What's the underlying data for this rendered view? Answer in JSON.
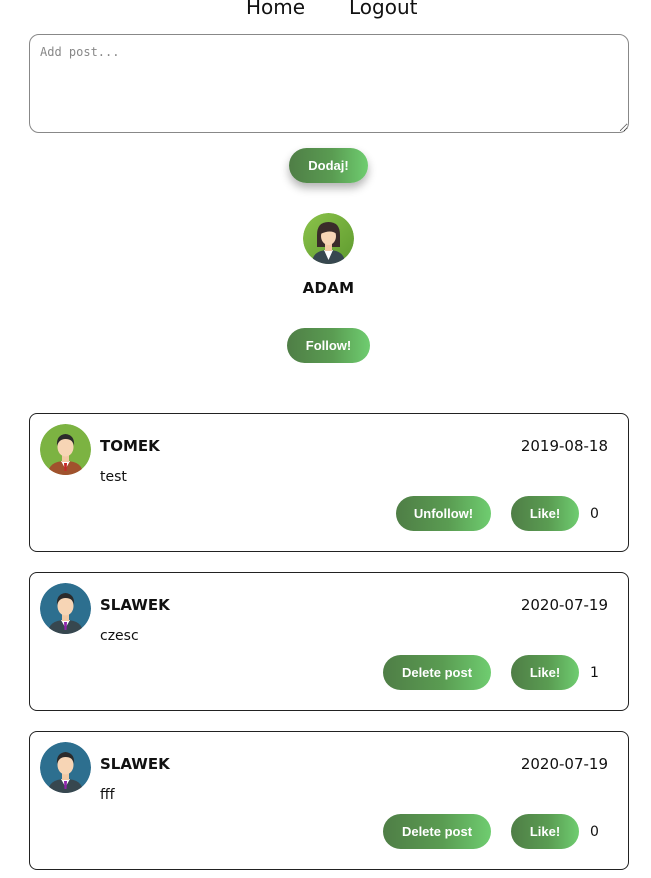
{
  "nav": {
    "home": "Home",
    "logout": "Logout"
  },
  "composer": {
    "placeholder": "Add post...",
    "submit_label": "Dodaj!"
  },
  "profile": {
    "name": "ADAM",
    "follow_label": "Follow!",
    "avatar_icon": "female-user-avatar-icon"
  },
  "posts": [
    {
      "author": "TOMEK",
      "date": "2019-08-18",
      "content": "test",
      "action_label": "Unfollow!",
      "like_label": "Like!",
      "likes": "0",
      "avatar_icon": "male-user-avatar-icon"
    },
    {
      "author": "SLAWEK",
      "date": "2020-07-19",
      "content": "czesc",
      "action_label": "Delete post",
      "like_label": "Like!",
      "likes": "1",
      "avatar_icon": "male-user-avatar-icon"
    },
    {
      "author": "SLAWEK",
      "date": "2020-07-19",
      "content": "fff",
      "action_label": "Delete post",
      "like_label": "Like!",
      "likes": "0",
      "avatar_icon": "male-user-avatar-icon"
    }
  ],
  "colors": {
    "button_gradient_start": "#4f7e46",
    "button_gradient_end": "#6fcd70",
    "avatar_green": "#7cb342",
    "avatar_blue": "#2d6f8f"
  }
}
